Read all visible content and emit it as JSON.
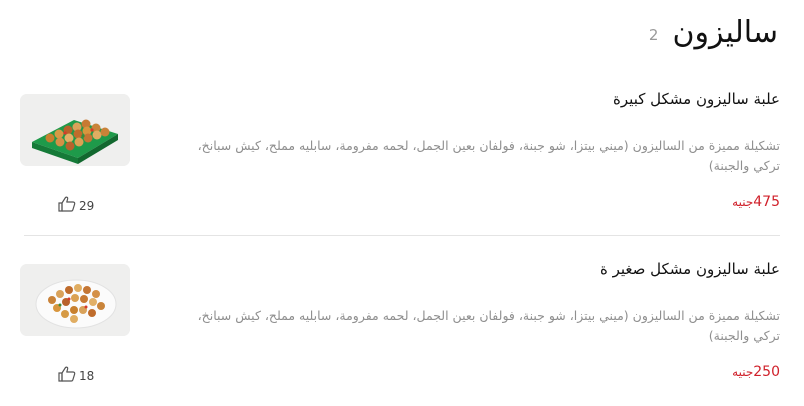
{
  "section": {
    "title": "ساليزون",
    "count": "2"
  },
  "items": [
    {
      "name": "علبة ساليزون مشكل كبيرة",
      "description": "تشكيلة مميزة من الساليزون (ميني بيتزا، شو جبنة، فولفان بعين الجمل، لحمه مفرومة، سابليه مملح، كيش سبانخ، تركي والجبنة)",
      "price": "475",
      "currency": "جنيه",
      "likes": "29",
      "image_icon": "gift-box-image"
    },
    {
      "name": "علبة ساليزون مشكل صغير ة",
      "description": "تشكيلة مميزة من الساليزون (ميني بيتزا، شو جبنة، فولفان بعين الجمل، لحمه مفرومة، سابليه مملح، كيش سبانخ، تركي والجبنة)",
      "price": "250",
      "currency": "جنيه",
      "likes": "18",
      "image_icon": "tray-image"
    }
  ],
  "colors": {
    "price": "#d0202a",
    "box_green": "#1e9a4a",
    "muted_text": "#8f8f8f"
  },
  "icons": {
    "like": "thumbs-up-icon"
  }
}
